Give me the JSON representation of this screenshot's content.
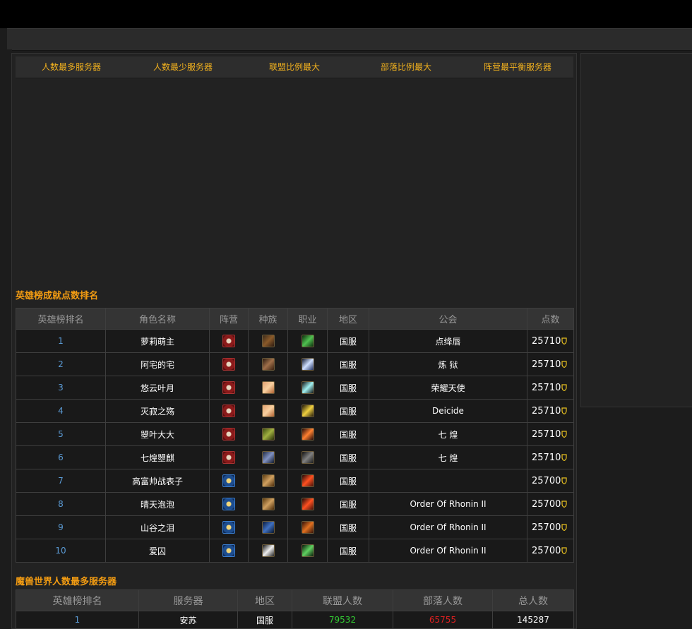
{
  "tabs": [
    "人数最多服务器",
    "人数最少服务器",
    "联盟比例最大",
    "部落比例最大",
    "阵营最平衡服务器"
  ],
  "colors": {
    "tab_text": "#f0b01e",
    "section_title": "#f39c12",
    "rank_blue": "#5b9bd5",
    "alliance_green": "#33cc33",
    "horde_red": "#e02020"
  },
  "hero_section": {
    "title": "英雄榜成就点数排名",
    "headers": [
      "英雄榜排名",
      "角色名称",
      "阵营",
      "种族",
      "职业",
      "地区",
      "公会",
      "点数"
    ],
    "rows": [
      {
        "rank": "1",
        "name": "萝莉萌主",
        "faction": "horde",
        "race": "race-1",
        "cls": "cls-1",
        "region": "国服",
        "guild": "点绛唇",
        "points": "25710"
      },
      {
        "rank": "2",
        "name": "阿宅的宅",
        "faction": "horde",
        "race": "race-2",
        "cls": "cls-2",
        "region": "国服",
        "guild": "炼 狱",
        "points": "25710"
      },
      {
        "rank": "3",
        "name": "悠云叶月",
        "faction": "horde",
        "race": "race-3",
        "cls": "cls-3",
        "region": "国服",
        "guild": "荣耀天使",
        "points": "25710"
      },
      {
        "rank": "4",
        "name": "灭寂之殇",
        "faction": "horde",
        "race": "race-3",
        "cls": "cls-4",
        "region": "国服",
        "guild": "Deicide",
        "points": "25710"
      },
      {
        "rank": "5",
        "name": "曌叶大大",
        "faction": "horde",
        "race": "race-4",
        "cls": "cls-5",
        "region": "国服",
        "guild": "七 煌",
        "points": "25710"
      },
      {
        "rank": "6",
        "name": "七煌曌麒",
        "faction": "horde",
        "race": "race-5",
        "cls": "cls-6",
        "region": "国服",
        "guild": "七 煌",
        "points": "25710"
      },
      {
        "rank": "7",
        "name": "高富帅战表子",
        "faction": "alliance",
        "race": "race-6",
        "cls": "cls-7",
        "region": "国服",
        "guild": "",
        "points": "25700"
      },
      {
        "rank": "8",
        "name": "晴天泡泡",
        "faction": "alliance",
        "race": "race-6",
        "cls": "cls-7",
        "region": "国服",
        "guild": "Order Of Rhonin II",
        "points": "25700"
      },
      {
        "rank": "9",
        "name": "山谷之泪",
        "faction": "alliance",
        "race": "race-7",
        "cls": "cls-8",
        "region": "国服",
        "guild": "Order Of Rhonin II",
        "points": "25700"
      },
      {
        "rank": "10",
        "name": "爱囚",
        "faction": "alliance",
        "race": "race-8",
        "cls": "cls-9",
        "region": "国服",
        "guild": "Order Of Rhonin II",
        "points": "25700"
      }
    ]
  },
  "server_section": {
    "title": "魔兽世界人数最多服务器",
    "headers": [
      "英雄榜排名",
      "服务器",
      "地区",
      "联盟人数",
      "部落人数",
      "总人数"
    ],
    "rows": [
      {
        "rank": "1",
        "server": "安苏",
        "region": "国服",
        "alliance": "79532",
        "horde": "65755",
        "total": "145287"
      }
    ]
  }
}
